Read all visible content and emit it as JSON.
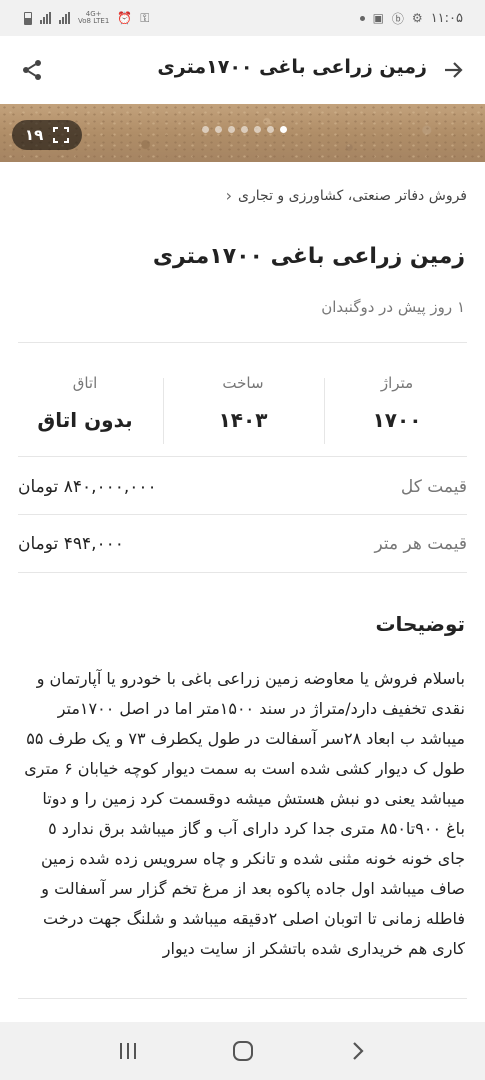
{
  "status_bar": {
    "time": "۱۱:۰۵",
    "network": "4G+",
    "lte": "Vo8 LTE1"
  },
  "app_bar": {
    "title": "زمین زراعی باغی ۱۷۰۰متری"
  },
  "gallery": {
    "photo_count": "۱۹",
    "dots_total": 7,
    "dot_active_index": 6
  },
  "breadcrumb": {
    "label": "فروش دفاتر صنعتی، کشاورزی و تجاری"
  },
  "listing": {
    "title": "زمین زراعی باغی ۱۷۰۰متری",
    "meta": "۱ روز پیش در دوگنبدان"
  },
  "specs": [
    {
      "label": "متراژ",
      "value": "۱۷۰۰"
    },
    {
      "label": "ساخت",
      "value": "۱۴۰۳"
    },
    {
      "label": "اتاق",
      "value": "بدون اتاق"
    }
  ],
  "price": {
    "total_label": "قیمت کل",
    "total_value": "۸۴۰,۰۰۰,۰۰۰ تومان",
    "per_meter_label": "قیمت هر متر",
    "per_meter_value": "۴۹۴,۰۰۰ تومان"
  },
  "description": {
    "title": "توضیحات",
    "text": "باسلام فروش یا معاوضه زمین زراعی باغی با خودرو یا آپارتمان و نقدی تخفیف دارد/متراژ در سند ۱۵۰۰متر اما در اصل ۱۷۰۰متر میباشد ب ابعاد ۲۸سر آسفالت در طول یکطرف ۷۳ و یک طرف ۵۵ طول ک دیوار کشی شده است به سمت دیوار کوچه خیابان ۶ متری میباشد یعنی دو نبش هستش میشه دوقسمت کرد زمین را و دوتا باغ ۹۰۰تا۸۵۰ متری جدا کرد دارای آب و گاز میباشد برق ندارد ٥ جای خونه خونه مثنی شده و تانکر و چاه سرویس زده شده زمین صاف میباشد اول جاده پاکوه بعد از مرغ تخم گزار سر آسفالت و فاطله زمانی تا اتوبان اصلی ۲دقیقه میباشد و شلنگ جهت درخت کاری هم خریداری شده باتشکر از سایت دیوار"
  },
  "colors": {
    "text_primary": "#222222",
    "text_secondary": "#777777",
    "divider": "#e6e6e6",
    "system_bar": "#f1f1f1"
  }
}
